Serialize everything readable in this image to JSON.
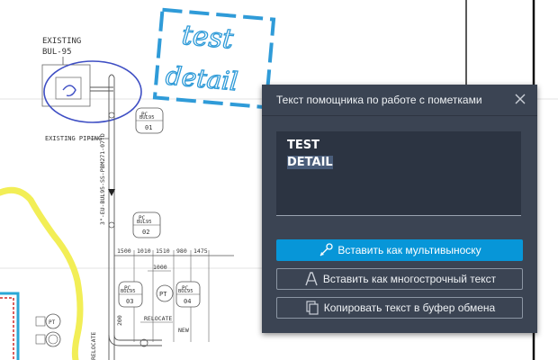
{
  "drawing": {
    "labels": {
      "existing_bul_line1": "EXISTING",
      "existing_bul_line2": "BUL-95",
      "existing_piping": "EXISTING PIPING",
      "pipe_spec": "3\"-EU-BUL95-SS-PBM271-07-D",
      "tag_pc": "PC",
      "tag_bul95": "BUL95",
      "tag_01": "01",
      "tag_02": "02",
      "tag_03": "03",
      "tag_04": "04",
      "tag_pt": "PT",
      "dim_1500": "1500",
      "dim_1010": "1010",
      "dim_1510": "1510",
      "dim_980": "980",
      "dim_1475": "1475",
      "dim_1000": "1000",
      "dim_200": "200",
      "relocate": "RELOCATE",
      "new": "NEW",
      "relocate_vertical": "RELOCATE"
    },
    "markup": {
      "handwriting_line1": "test",
      "handwriting_line2": "detail",
      "colors": {
        "markup_blue": "#2f9bd8",
        "sketch_blue": "#3f4fc4",
        "highlight_yellow": "#f2ee56",
        "frame_cyan": "#2aa7d6"
      }
    }
  },
  "panel": {
    "title": "Текст помощника по работе с пометками",
    "close_icon": "close-icon",
    "recognized_text": {
      "line1": "TEST",
      "line2": "DETAIL"
    },
    "buttons": {
      "insert_mleader": "Вставить как мультивыноску",
      "insert_mtext": "Вставить как многострочный текст",
      "copy_clipboard": "Копировать текст в буфер обмена"
    },
    "colors": {
      "panel_bg": "#3b4453",
      "primary_button": "#0796d8",
      "textarea_bg": "#2c3442"
    }
  }
}
